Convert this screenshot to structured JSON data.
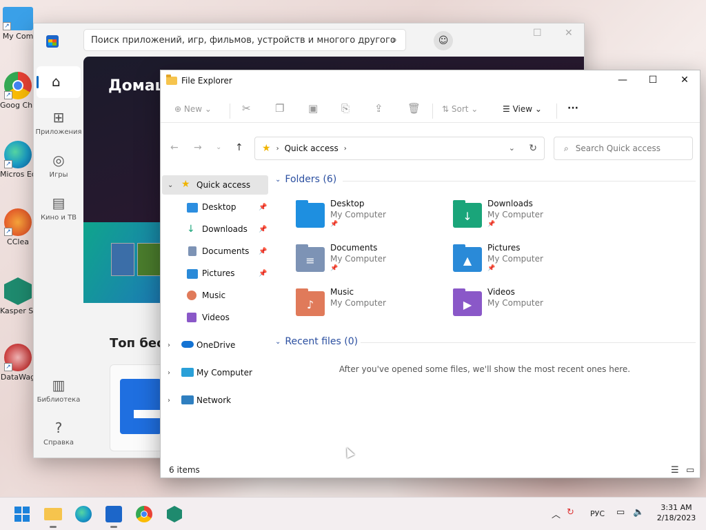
{
  "desktop": {
    "icons": [
      {
        "label": "My Com",
        "icon": "computer-icon",
        "color": "#3aa0e8"
      },
      {
        "label": "Goog Chron",
        "icon": "chrome-icon",
        "color": "#e94235"
      },
      {
        "label": "Micros Edg",
        "icon": "edge-icon",
        "color": "#1da0c6"
      },
      {
        "label": "CClea",
        "icon": "ccleaner-icon",
        "color": "#e35b2a"
      },
      {
        "label": "Kasper Securi",
        "icon": "kaspersky-icon",
        "color": "#1e8a6e"
      },
      {
        "label": "DataWag",
        "icon": "datawag-icon",
        "color": "#c83a3a"
      }
    ]
  },
  "store": {
    "search_placeholder": "Поиск приложений, игр, фильмов, устройств и многого другого",
    "nav": {
      "apps": "Приложения",
      "games": "Игры",
      "movies": "Кино и ТВ",
      "library": "Библиотека",
      "help": "Справка"
    },
    "hero_title": "Домаш",
    "section_title": "Топ бесп"
  },
  "explorer": {
    "title": "File Explorer",
    "toolbar": {
      "new": "New",
      "sort": "Sort",
      "view": "View",
      "more": "···"
    },
    "address": {
      "location": "Quick access"
    },
    "search_placeholder": "Search Quick access",
    "sidebar": {
      "quick_access": "Quick access",
      "pinned": [
        {
          "label": "Desktop",
          "icon": "desktop-folder-icon",
          "pinned": true
        },
        {
          "label": "Downloads",
          "icon": "downloads-icon",
          "pinned": true
        },
        {
          "label": "Documents",
          "icon": "documents-icon",
          "pinned": true
        },
        {
          "label": "Pictures",
          "icon": "pictures-icon",
          "pinned": true
        },
        {
          "label": "Music",
          "icon": "music-icon",
          "pinned": false
        },
        {
          "label": "Videos",
          "icon": "videos-icon",
          "pinned": false
        }
      ],
      "onedrive": "OneDrive",
      "my_computer": "My Computer",
      "network": "Network"
    },
    "folders_header": "Folders (6)",
    "folders": [
      {
        "name": "Desktop",
        "location": "My Computer",
        "pinned": true,
        "color": "#1e8fe0",
        "glyph": ""
      },
      {
        "name": "Downloads",
        "location": "My Computer",
        "pinned": true,
        "color": "#1aa57a",
        "glyph": "↓"
      },
      {
        "name": "Documents",
        "location": "My Computer",
        "pinned": true,
        "color": "#7d93b5",
        "glyph": "≡"
      },
      {
        "name": "Pictures",
        "location": "My Computer",
        "pinned": true,
        "color": "#2a8ad8",
        "glyph": "▲"
      },
      {
        "name": "Music",
        "location": "My Computer",
        "pinned": false,
        "color": "#e07a5a",
        "glyph": "♪"
      },
      {
        "name": "Videos",
        "location": "My Computer",
        "pinned": false,
        "color": "#8a58c8",
        "glyph": "▶"
      }
    ],
    "recent_header": "Recent files (0)",
    "recent_empty": "After you've opened some files, we'll show the most recent ones here.",
    "status": "6 items"
  },
  "taskbar": {
    "lang": "РУС",
    "time": "3:31 AM",
    "date": "2/18/2023"
  }
}
